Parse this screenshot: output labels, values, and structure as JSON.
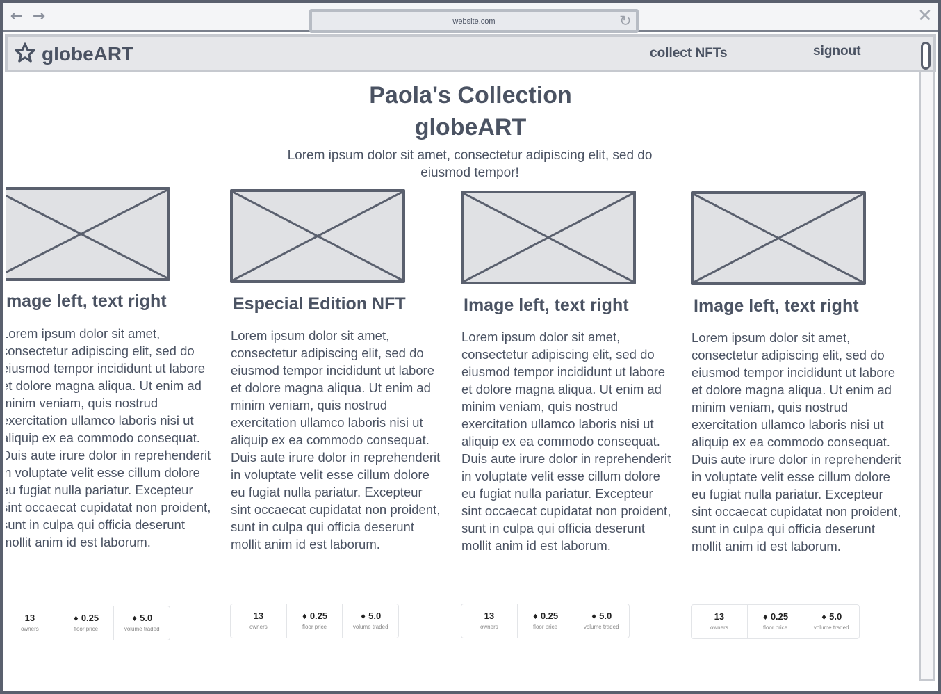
{
  "browser": {
    "url": "website.com",
    "back_icon": "arrow-left-icon",
    "forward_icon": "arrow-right-icon",
    "reload_icon": "reload-icon",
    "close_icon": "close-icon"
  },
  "nav": {
    "brand": "globeART",
    "logo_icon": "star-icon",
    "links": [
      "collect NFTs",
      "signout"
    ]
  },
  "header": {
    "title_line1": "Paola's Collection",
    "title_line2": "globeART",
    "subtitle": "Lorem ipsum dolor sit amet, consectetur adipiscing elit, sed do eiusmod tempor!"
  },
  "cards": [
    {
      "title": "Image left, text right",
      "body": "Lorem ipsum dolor sit amet, consectetur adipiscing elit, sed do eiusmod tempor incididunt ut labore et dolore magna aliqua. Ut enim ad minim veniam, quis nostrud exercitation ullamco laboris nisi ut aliquip ex ea commodo consequat. Duis aute irure dolor in reprehenderit in voluptate velit esse cillum dolore eu fugiat nulla pariatur. Excepteur sint occaecat cupidatat non proident, sunt in culpa qui officia deserunt mollit anim id est laborum.",
      "stats": [
        {
          "value": "13",
          "label": "owners",
          "eth": false
        },
        {
          "value": "0.25",
          "label": "floor price",
          "eth": true
        },
        {
          "value": "5.0",
          "label": "volume traded",
          "eth": true
        }
      ]
    },
    {
      "title": "Especial Edition NFT",
      "body": "Lorem ipsum dolor sit amet, consectetur adipiscing elit, sed do eiusmod tempor incididunt ut labore et dolore magna aliqua. Ut enim ad minim veniam, quis nostrud exercitation ullamco laboris nisi ut aliquip ex ea commodo consequat. Duis aute irure dolor in reprehenderit in voluptate velit esse cillum dolore eu fugiat nulla pariatur. Excepteur sint occaecat cupidatat non proident, sunt in culpa qui officia deserunt mollit anim id est laborum.",
      "stats": [
        {
          "value": "13",
          "label": "owners",
          "eth": false
        },
        {
          "value": "0.25",
          "label": "floor price",
          "eth": true
        },
        {
          "value": "5.0",
          "label": "volume traded",
          "eth": true
        }
      ]
    },
    {
      "title": "Image left, text right",
      "body": "Lorem ipsum dolor sit amet, consectetur adipiscing elit, sed do eiusmod tempor incididunt ut labore et dolore magna aliqua. Ut enim ad minim veniam, quis nostrud exercitation ullamco laboris nisi ut aliquip ex ea commodo consequat. Duis aute irure dolor in reprehenderit in voluptate velit esse cillum dolore eu fugiat nulla pariatur. Excepteur sint occaecat cupidatat non proident, sunt in culpa qui officia deserunt mollit anim id est laborum.",
      "stats": [
        {
          "value": "13",
          "label": "owners",
          "eth": false
        },
        {
          "value": "0.25",
          "label": "floor price",
          "eth": true
        },
        {
          "value": "5.0",
          "label": "volume traded",
          "eth": true
        }
      ]
    },
    {
      "title": "Image left, text right",
      "body": "Lorem ipsum dolor sit amet, consectetur adipiscing elit, sed do eiusmod tempor incididunt ut labore et dolore magna aliqua. Ut enim ad minim veniam, quis nostrud exercitation ullamco laboris nisi ut aliquip ex ea commodo consequat. Duis aute irure dolor in reprehenderit in voluptate velit esse cillum dolore eu fugiat nulla pariatur. Excepteur sint occaecat cupidatat non proident, sunt in culpa qui officia deserunt mollit anim id est laborum.",
      "stats": [
        {
          "value": "13",
          "label": "owners",
          "eth": false
        },
        {
          "value": "0.25",
          "label": "floor price",
          "eth": true
        },
        {
          "value": "5.0",
          "label": "volume traded",
          "eth": true
        }
      ]
    }
  ],
  "colors": {
    "text": "#4b5363",
    "frame": "#5a606e",
    "placeholder_fill": "#e0e1e4",
    "navbar_bg": "#e6e7ea"
  }
}
